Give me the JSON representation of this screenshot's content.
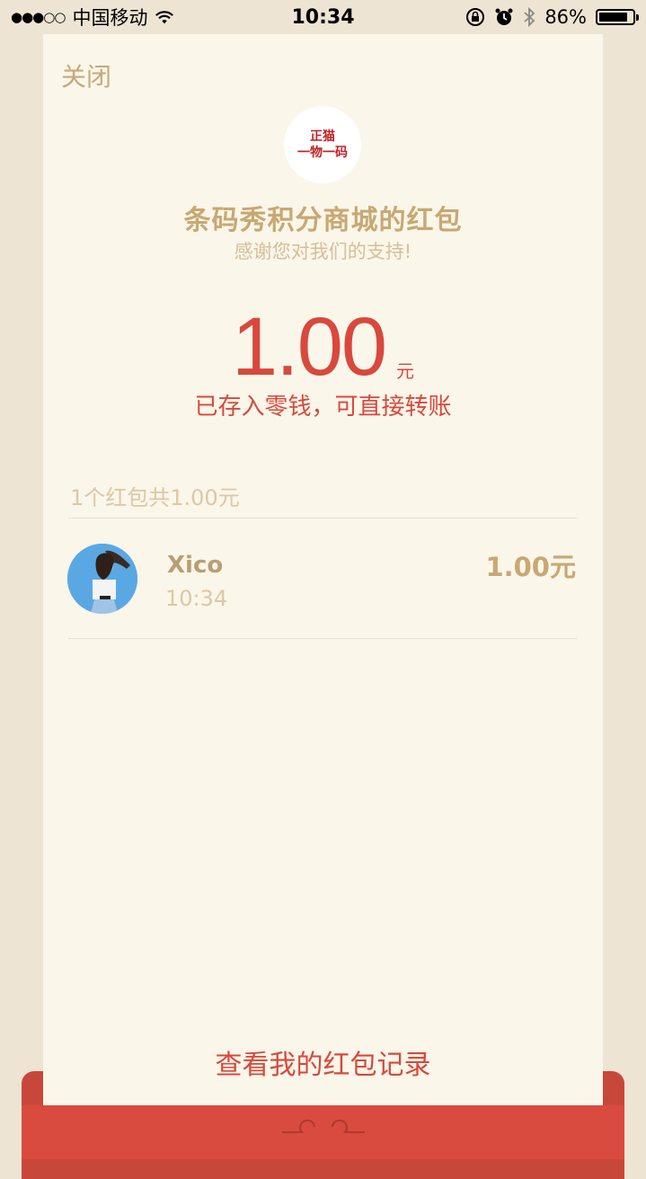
{
  "status_bar": {
    "signal": "●●●○○",
    "carrier": "中国移动",
    "time": "10:34",
    "battery_percent": "86%",
    "battery_level": 0.86
  },
  "card": {
    "close_label": "关闭",
    "logo_line1": "正猫",
    "logo_line2": "一物一码",
    "sender_title": "条码秀积分商城的红包",
    "sender_subtitle": "感谢您对我们的支持!",
    "amount": "1.00",
    "amount_unit": "元",
    "stored_note": "已存入零钱，可直接转账",
    "summary": "1个红包共1.00元",
    "receiver": {
      "name": "Xico",
      "time": "10:34",
      "amount": "1.00元"
    },
    "records_link": "查看我的红包记录"
  },
  "colors": {
    "accent_red": "#d9483c",
    "gold_text": "#c8a872",
    "card_bg": "#faf6ea",
    "page_bg": "#ede4d3"
  }
}
